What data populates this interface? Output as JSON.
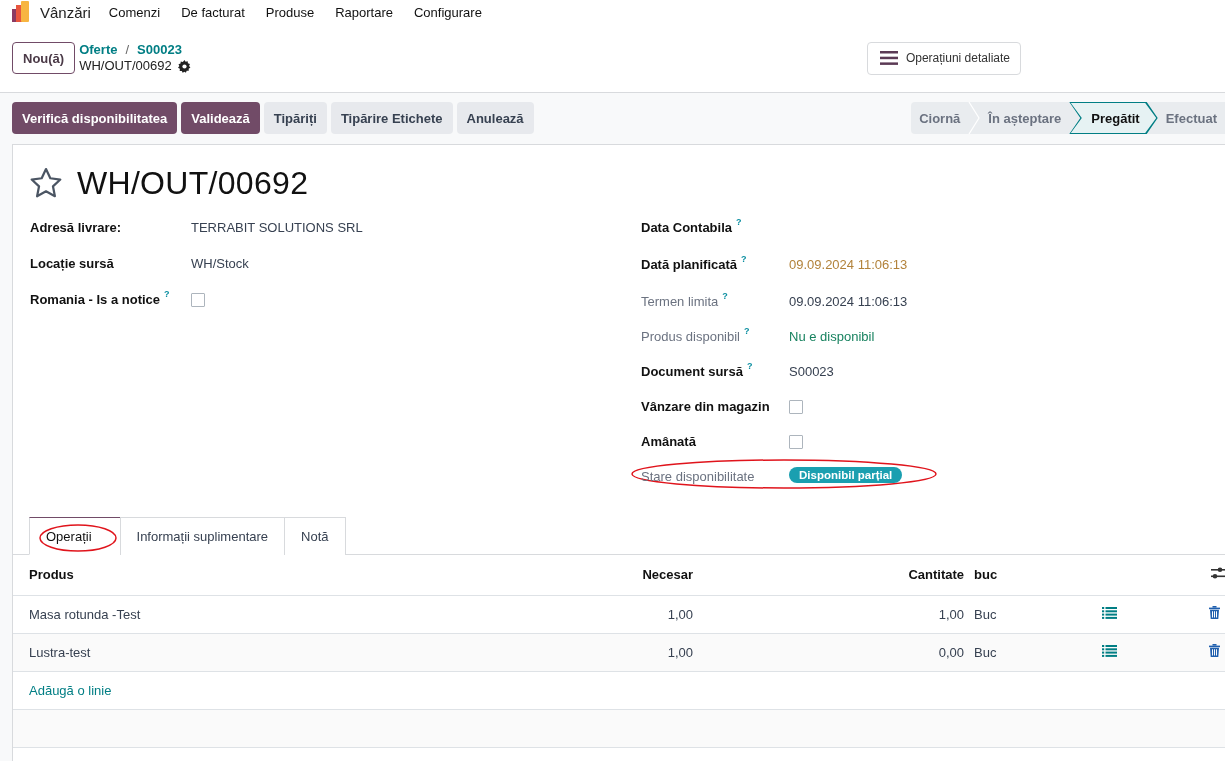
{
  "app": {
    "name": "Vânzări"
  },
  "menu": [
    "Comenzi",
    "De facturat",
    "Produse",
    "Raportare",
    "Configurare"
  ],
  "control_panel": {
    "new_button": "Nou(ă)",
    "breadcrumb": [
      "Oferte",
      "S00023"
    ],
    "breadcrumb_separator": "/",
    "record": "WH/OUT/00692",
    "detailed_button": "Operațiuni detaliate"
  },
  "actions": [
    {
      "label": "Verifică disponibilitatea",
      "primary": true
    },
    {
      "label": "Validează",
      "primary": true
    },
    {
      "label": "Tipăriți",
      "primary": false
    },
    {
      "label": "Tipărire Etichete",
      "primary": false
    },
    {
      "label": "Anulează",
      "primary": false
    }
  ],
  "status_steps": [
    {
      "label": "Ciornă",
      "selected": false
    },
    {
      "label": "În așteptare",
      "selected": false
    },
    {
      "label": "Pregătit",
      "selected": true
    },
    {
      "label": "Efectuat",
      "selected": false
    }
  ],
  "title": {
    "text": "WH/OUT/00692",
    "starred": false
  },
  "left_fields": [
    {
      "label": "Adresă livrare:",
      "kind": "text",
      "value": "TERRABIT SOLUTIONS SRL",
      "muted": false
    },
    {
      "label": "Locație sursă",
      "kind": "text",
      "value": "WH/Stock",
      "muted": false
    },
    {
      "label": "Romania - Is a notice",
      "help": "?",
      "kind": "checkbox",
      "checked": false,
      "muted": false
    }
  ],
  "right_fields": [
    {
      "label": "Data Contabila",
      "help": "?",
      "kind": "empty",
      "muted": false
    },
    {
      "label": "Dată planificată",
      "help": "?",
      "kind": "text",
      "value": "09.09.2024 11:06:13",
      "color": "#b2823a",
      "muted": false
    },
    {
      "label": "Termen limita",
      "help": "?",
      "kind": "text",
      "value": "09.09.2024 11:06:13",
      "color": "#374151",
      "muted": true
    },
    {
      "label": "Produs disponibil",
      "help": "?",
      "kind": "text",
      "value": "Nu e disponibil",
      "color": "#17825f",
      "muted": true
    },
    {
      "label": "Document sursă",
      "help": "?",
      "kind": "text",
      "value": "S00023",
      "color": "#374151",
      "muted": false
    },
    {
      "label": "Vânzare din magazin",
      "kind": "checkbox",
      "checked": false,
      "muted": false
    },
    {
      "label": "Amânată",
      "kind": "checkbox",
      "checked": false,
      "muted": false
    },
    {
      "label": "Stare disponibilitate",
      "kind": "badge",
      "value": "Disponibil parțial",
      "muted": true,
      "highlighted": true
    }
  ],
  "tabs": [
    {
      "label": "Operații",
      "selected": true,
      "highlighted": true
    },
    {
      "label": "Informații suplimentare",
      "selected": false,
      "highlighted": false
    },
    {
      "label": "Notă",
      "selected": false,
      "highlighted": false
    }
  ],
  "table": {
    "columns": [
      "Produs",
      "Necesar",
      "Cantitate",
      "buc"
    ],
    "rows": [
      {
        "product": "Masa rotunda -Test",
        "required": "1,00",
        "quantity": "1,00",
        "uom": "Buc"
      },
      {
        "product": "Lustra-test",
        "required": "1,00",
        "quantity": "0,00",
        "uom": "Buc"
      }
    ],
    "add_line": "Adăugă o linie"
  }
}
